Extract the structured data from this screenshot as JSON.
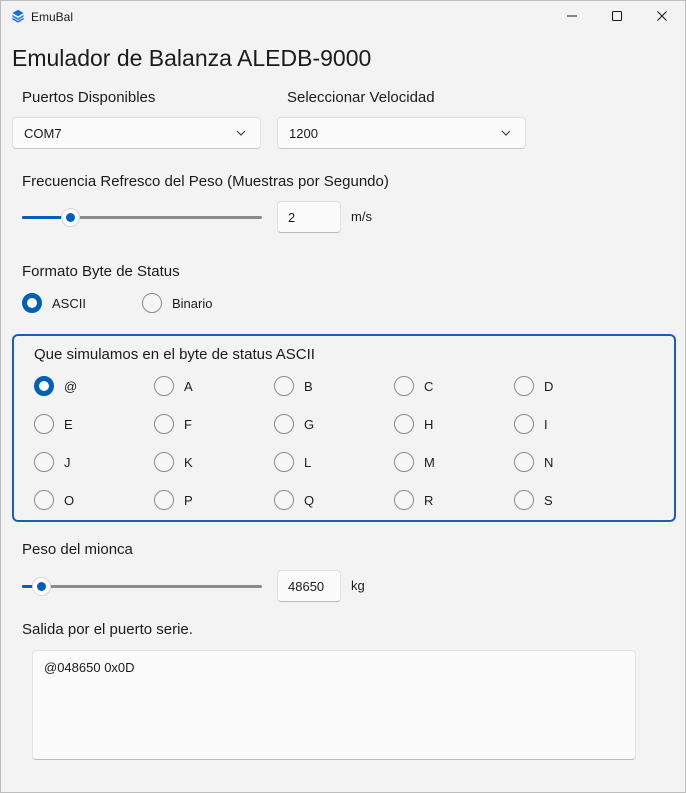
{
  "window": {
    "title": "EmuBal",
    "accent_color": "#005fb8"
  },
  "page": {
    "title": "Emulador de Balanza ALEDB-9000"
  },
  "ports": {
    "label": "Puertos Disponibles",
    "selected": "COM7"
  },
  "speed": {
    "label": "Seleccionar Velocidad",
    "selected": "1200"
  },
  "refresh": {
    "label": "Frecuencia Refresco del Peso (Muestras por Segundo)",
    "value": "2",
    "unit": "m/s",
    "slider_fraction": 0.2
  },
  "status_format": {
    "label": "Formato Byte de Status",
    "options": [
      {
        "label": "ASCII",
        "checked": true
      },
      {
        "label": "Binario",
        "checked": false
      }
    ]
  },
  "ascii_status": {
    "title": "Que simulamos en el byte de status ASCII",
    "options": [
      "@",
      "A",
      "B",
      "C",
      "D",
      "E",
      "F",
      "G",
      "H",
      "I",
      "J",
      "K",
      "L",
      "M",
      "N",
      "O",
      "P",
      "Q",
      "R",
      "S"
    ],
    "selected": "@"
  },
  "weight": {
    "label": "Peso del mionca",
    "value": "48650",
    "unit": "kg",
    "slider_fraction": 0.08
  },
  "serial_output": {
    "label": "Salida por el puerto serie.",
    "text": "@048650 0x0D"
  },
  "icons": [
    "app-logo-icon",
    "minimize-icon",
    "maximize-icon",
    "close-icon",
    "chevron-down-icon"
  ]
}
